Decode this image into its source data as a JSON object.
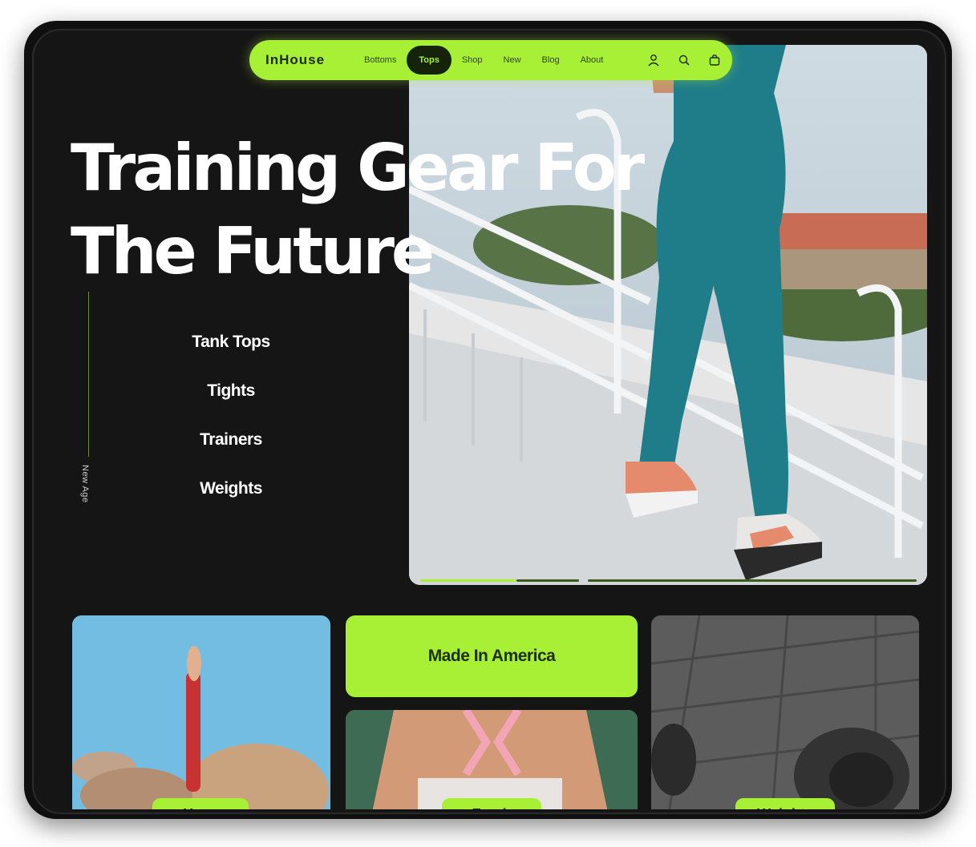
{
  "nav": {
    "logo": "InHouse",
    "links": [
      "Bottoms",
      "Tops",
      "Shop",
      "New",
      "Blog",
      "About"
    ],
    "active_link": "Tops",
    "icons": [
      "user-icon",
      "search-icon",
      "bag-icon"
    ]
  },
  "hero": {
    "title_line1": "Training Gear For",
    "title_line2": "The Future",
    "vertical_label": "New Age",
    "categories": [
      "Tank Tops",
      "Tights",
      "Trainers",
      "Weights"
    ]
  },
  "bottom": {
    "badge": "Made In America",
    "pills": [
      "Yoga",
      "Fresh",
      "Weights"
    ]
  },
  "colors": {
    "accent": "#a7f036",
    "background": "#151515",
    "text": "#ffffff"
  }
}
